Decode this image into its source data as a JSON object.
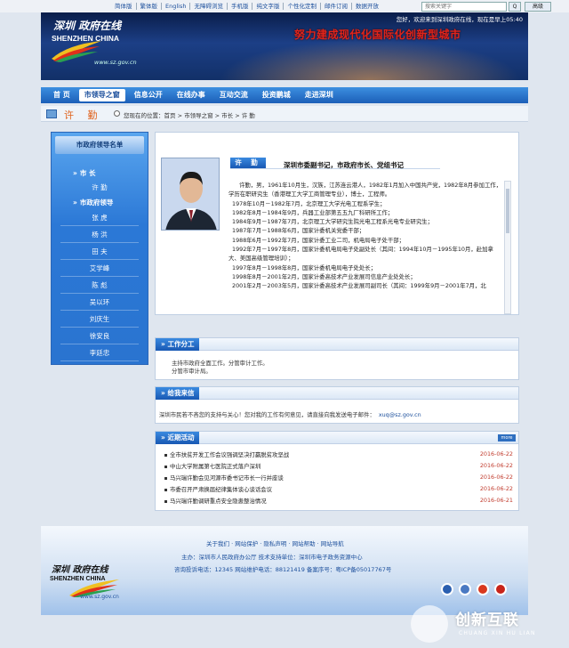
{
  "topbar": {
    "links": [
      "简体版",
      "繁体版",
      "English",
      "无障碍浏览",
      "手机版",
      "纯文字版",
      "个性化定制",
      "邮件订阅",
      "数据开放"
    ],
    "search_placeholder": "搜索关键字",
    "search_button": "Q",
    "advanced_button": "高级"
  },
  "banner": {
    "greeting": "您好，欢迎来到深圳政府在线，现在是早上05:40",
    "slogan": "努力建成现代化国际化创新型城市",
    "logo_cn": "深圳 政府在线",
    "logo_en": "SHENZHEN CHINA",
    "logo_url": "www.sz.gov.cn"
  },
  "nav": {
    "items": [
      "首 页",
      "市领导之窗",
      "信息公开",
      "在线办事",
      "互动交流",
      "投资鹏城",
      "走进深圳"
    ],
    "active_index": 1
  },
  "subnav": {
    "title": "许 勤",
    "breadcrumb": "您现在的位置：首页 > 市领导之窗 > 市长 > 许 勤"
  },
  "sidebar": {
    "heading": "市政府领导名单",
    "mayor_category": "市 长",
    "mayor_name": "许 勤",
    "leaders_category": "市政府领导",
    "leaders": [
      "张 虎",
      "杨 洪",
      "田 夫",
      "艾学峰",
      "陈 彪",
      "吴以环",
      "刘庆生",
      "徐安良",
      "李廷忠"
    ]
  },
  "profile": {
    "name": "许 勤",
    "title": "深圳市委副书记，市政府市长、党组书记",
    "bio": [
      "许勤，男，1961年10月生，汉族，江苏连云港人，1982年1月加入中国共产党，1982年8月参加工作，学历在职研究生（香港理工大学工商管理专业），博士，工程师。",
      "1978年10月－1982年7月，北京理工大学光电工程系学生；",
      "1982年8月－1984年9月，兵器工业部第五五九厂科研所工作；",
      "1984年9月－1987年7月，北京理工大学研究生院光电工程系光电专业研究生；",
      "1987年7月－1988年6月，国家计委机关党委干部；",
      "1988年6月－1992年7月，国家计委工业二司，机电局电子处干部；",
      "1992年7月－1997年8月，国家计委机电局电子处副处长（其间：1994年10月－1995年10月，赴加拿大、美国高级管理培训）；",
      "1997年8月－1998年8月，国家计委机电局电子处处长；",
      "1998年8月－2001年2月，国家计委高技术产业发展司信息产业处处长；",
      "2001年2月－2003年5月，国家计委高技术产业发展司副司长（其间：1999年9月－2001年7月，北"
    ]
  },
  "work": {
    "heading": "工作分工",
    "text": [
      "主持市政府全面工作。分管审计工作。",
      "分管市审计局。"
    ]
  },
  "mail": {
    "heading": "给我来信",
    "text": "深圳市民若不吝您的支持与关心！您对我的工作有何意见，请直接向我发送电子邮件：",
    "email": "xuq@sz.gov.cn"
  },
  "news": {
    "heading": "近期活动",
    "more": "more",
    "items": [
      {
        "title": "全市扶贫开发工作会议强调坚决打赢脱贫攻坚战",
        "date": "2016-06-22"
      },
      {
        "title": "中山大学附属第七医院正式落户深圳",
        "date": "2016-06-22"
      },
      {
        "title": "马兴瑞许勤会见河源市委书记市长一行并座谈",
        "date": "2016-06-22"
      },
      {
        "title": "市委召开严肃换届纪律集体谈心谈话会议",
        "date": "2016-06-22"
      },
      {
        "title": "马兴瑞许勤调研重点安全隐患整治情况",
        "date": "2016-06-21"
      }
    ]
  },
  "footer": {
    "links": "关于我们 · 网站保护 · 隐私声明 · 网站帮助 · 网站导航",
    "line1": "主办：深圳市人民政府办公厅  技术支持单位：深圳市电子政务资源中心",
    "line2": "咨询投诉电话：12345  网站维护电话：88121419  备案序号：粤ICP备05017767号",
    "logo_cn": "深圳 政府在线",
    "logo_en": "SHENZHEN CHINA",
    "logo_url": "www.sz.gov.cn"
  },
  "watermark": {
    "cn": "创新互联",
    "en": "CHUANG XIN HU LIAN"
  }
}
